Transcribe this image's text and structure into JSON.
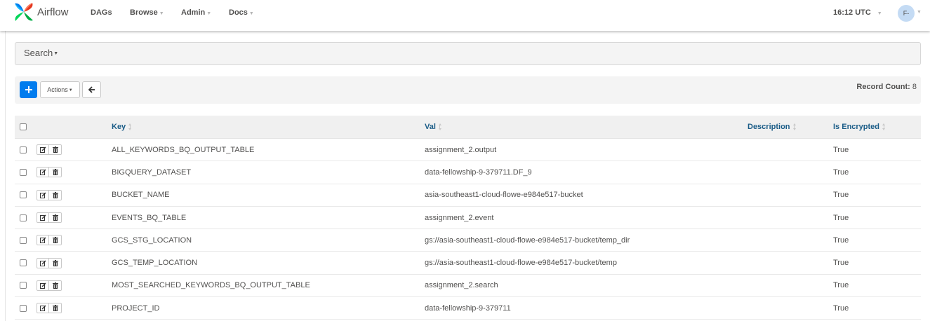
{
  "navbar": {
    "brand": "Airflow",
    "menu": [
      {
        "label": "DAGs",
        "has_dropdown": false
      },
      {
        "label": "Browse",
        "has_dropdown": true
      },
      {
        "label": "Admin",
        "has_dropdown": true
      },
      {
        "label": "Docs",
        "has_dropdown": true
      }
    ],
    "time": "16:12 UTC",
    "user_initials": "F-"
  },
  "search": {
    "label": "Search"
  },
  "toolbar": {
    "add_icon": "plus-icon",
    "actions_label": "Actions",
    "back_icon": "arrow-left-icon",
    "record_count_label": "Record Count:",
    "record_count_value": "8"
  },
  "table": {
    "columns": [
      "Key",
      "Val",
      "Description",
      "Is Encrypted"
    ],
    "rows": [
      {
        "key": "ALL_KEYWORDS_BQ_OUTPUT_TABLE",
        "val": "assignment_2.output",
        "description": "",
        "is_encrypted": "True"
      },
      {
        "key": "BIGQUERY_DATASET",
        "val": "data-fellowship-9-379711.DF_9",
        "description": "",
        "is_encrypted": "True"
      },
      {
        "key": "BUCKET_NAME",
        "val": "asia-southeast1-cloud-flowe-e984e517-bucket",
        "description": "",
        "is_encrypted": "True"
      },
      {
        "key": "EVENTS_BQ_TABLE",
        "val": "assignment_2.event",
        "description": "",
        "is_encrypted": "True"
      },
      {
        "key": "GCS_STG_LOCATION",
        "val": "gs://asia-southeast1-cloud-flowe-e984e517-bucket/temp_dir",
        "description": "",
        "is_encrypted": "True"
      },
      {
        "key": "GCS_TEMP_LOCATION",
        "val": "gs://asia-southeast1-cloud-flowe-e984e517-bucket/temp",
        "description": "",
        "is_encrypted": "True"
      },
      {
        "key": "MOST_SEARCHED_KEYWORDS_BQ_OUTPUT_TABLE",
        "val": "assignment_2.search",
        "description": "",
        "is_encrypted": "True"
      },
      {
        "key": "PROJECT_ID",
        "val": "data-fellowship-9-379711",
        "description": "",
        "is_encrypted": "True"
      }
    ]
  },
  "colors": {
    "primary": "#017cee",
    "avatar_bg": "#c4dbf4",
    "header_link": "#1a5c87"
  }
}
